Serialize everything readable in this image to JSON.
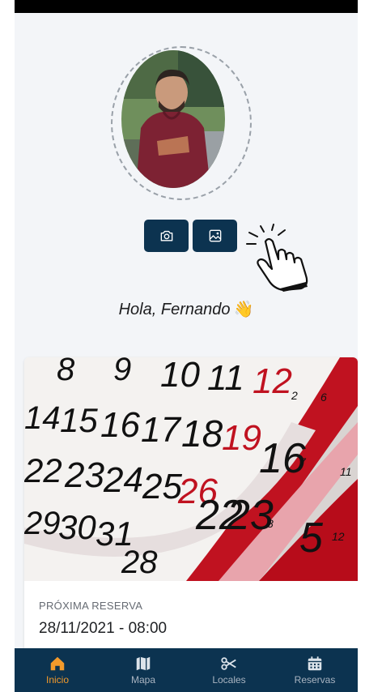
{
  "profile": {
    "greeting": "Hola, Fernando",
    "greeting_emoji": "👋",
    "camera_icon": "camera-icon",
    "gallery_icon": "image-icon"
  },
  "card": {
    "image_icon": "calendar-photo",
    "label": "PRÓXIMA RESERVA",
    "datetime": "28/11/2021 - 08:00"
  },
  "nav": {
    "items": [
      {
        "label": "Inicio",
        "icon": "home-icon",
        "active": true
      },
      {
        "label": "Mapa",
        "icon": "map-icon",
        "active": false
      },
      {
        "label": "Locales",
        "icon": "scissors-icon",
        "active": false
      },
      {
        "label": "Reservas",
        "icon": "calendar-icon",
        "active": false
      }
    ]
  },
  "colors": {
    "primary": "#0c3350",
    "active": "#f39a2b",
    "background": "#f3f5f8"
  }
}
